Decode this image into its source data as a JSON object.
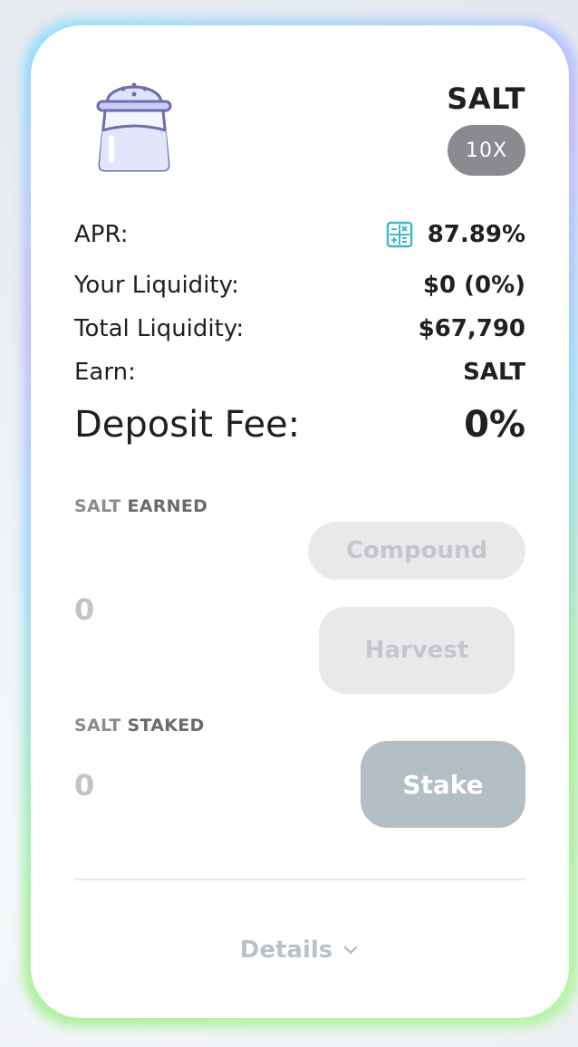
{
  "farm": {
    "token_name": "SALT",
    "multiplier": "10X",
    "icons": {
      "token": "salt-shaker-icon",
      "calculator": "calculator-icon",
      "details_chevron": "chevron-down-icon"
    }
  },
  "stats": {
    "apr_label": "APR:",
    "apr_value": "87.89%",
    "your_liquidity_label": "Your Liquidity:",
    "your_liquidity_value": "$0 (0%)",
    "total_liquidity_label": "Total Liquidity:",
    "total_liquidity_value": "$67,790",
    "earn_label": "Earn:",
    "earn_value": "SALT",
    "deposit_fee_label": "Deposit Fee:",
    "deposit_fee_value": "0%"
  },
  "earned": {
    "token": "SALT",
    "label": "EARNED",
    "amount": "0",
    "compound_label": "Compound",
    "harvest_label": "Harvest"
  },
  "staked": {
    "token": "SALT",
    "label": "STAKED",
    "amount": "0",
    "stake_label": "Stake"
  },
  "footer": {
    "details_label": "Details"
  },
  "colors": {
    "accent_calculator": "#3fb8c9",
    "multiplier_bg": "#8a8a8f",
    "stake_bg": "#b4bec5",
    "disabled_bg": "#e8e9eb"
  }
}
